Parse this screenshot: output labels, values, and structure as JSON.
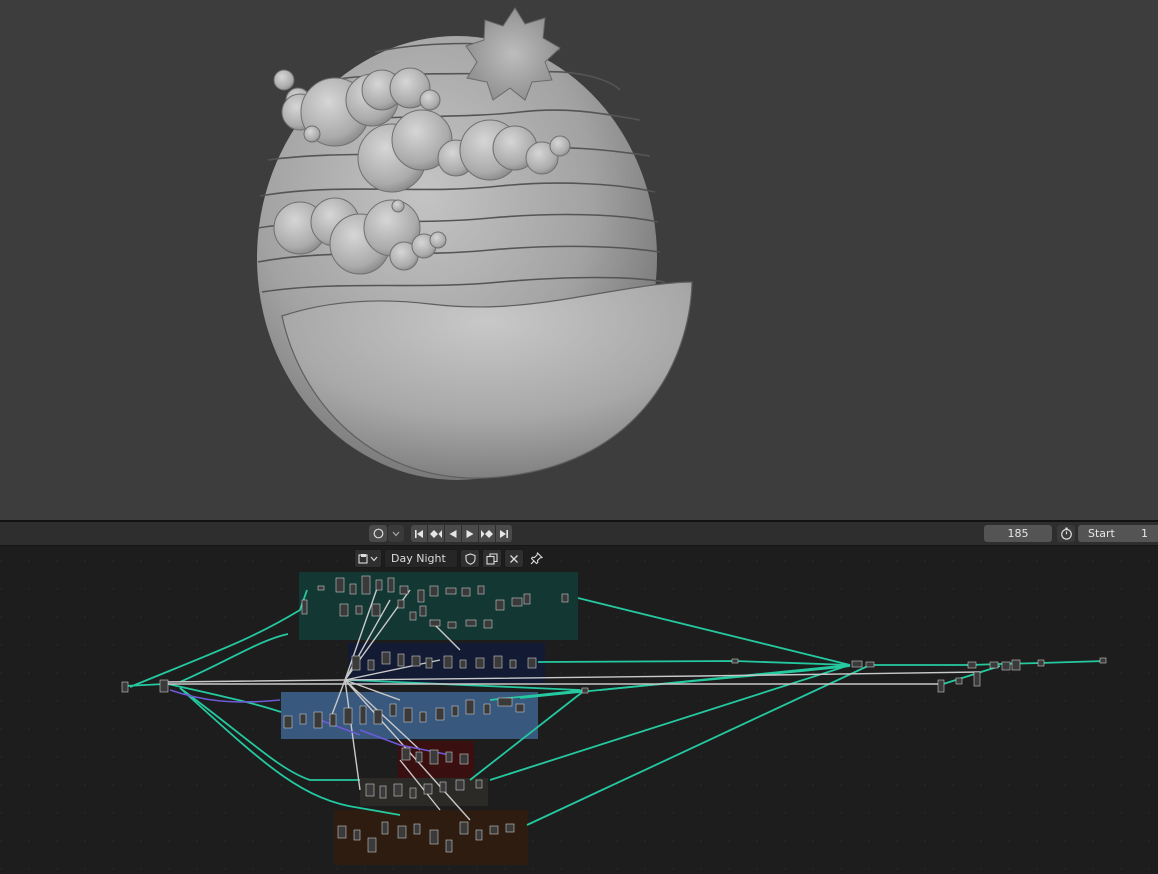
{
  "timeline": {
    "current_frame": "185",
    "start_label": "Start",
    "start_value": "1",
    "playback_icons": [
      "jump-start-icon",
      "prev-keyframe-icon",
      "play-reverse-icon",
      "play-icon",
      "next-keyframe-icon",
      "jump-end-icon"
    ]
  },
  "node_editor": {
    "node_tree_name": "Day Night",
    "frame_colors": {
      "frame_1": "#133733",
      "frame_2": "#131a33",
      "frame_3": "#38587d",
      "frame_4": "#3a0f0f",
      "frame_5": "#2c2a26",
      "frame_6": "#2d1c0f"
    },
    "link_color": "#25c9a0",
    "link_color_secondary": "#c9c9c9",
    "link_color_purple": "#6d5ad6"
  },
  "viewport": {
    "background_color": "#3d3d3d"
  }
}
